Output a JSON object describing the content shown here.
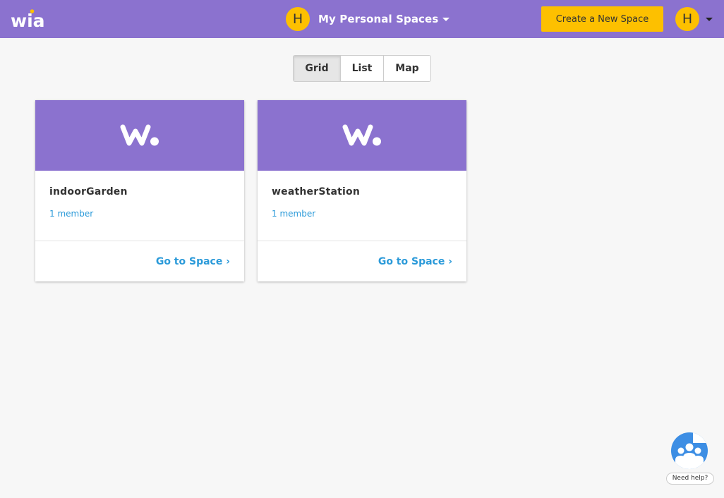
{
  "header": {
    "logo_text": "wia",
    "space_avatar": "H",
    "space_title": "My Personal Spaces",
    "create_button": "Create a New Space",
    "user_avatar": "H"
  },
  "view_toggle": {
    "options": [
      "Grid",
      "List",
      "Map"
    ],
    "active": "Grid"
  },
  "spaces": [
    {
      "name": "indoorGarden",
      "members": "1 member",
      "link": "Go to Space ›"
    },
    {
      "name": "weatherStation",
      "members": "1 member",
      "link": "Go to Space ›"
    }
  ],
  "help": {
    "label": "Need help?"
  },
  "colors": {
    "brand_purple": "#8b72cf",
    "accent_yellow": "#fdc000",
    "link_blue": "#2b9ad9"
  },
  "icons": {
    "logo": "wia-logo-icon",
    "space_card": "wia-w-mark-icon",
    "help": "community-help-icon"
  }
}
